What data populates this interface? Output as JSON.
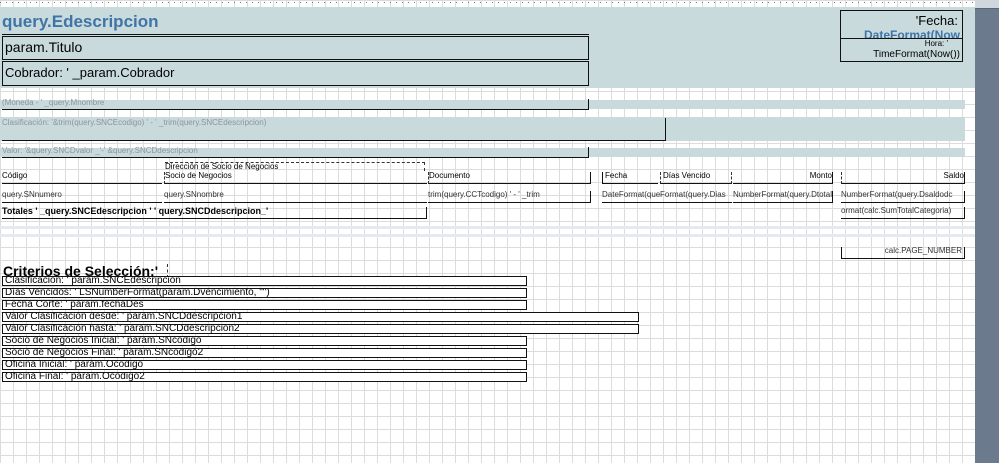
{
  "header": {
    "query_title": "query.Edescripcion",
    "param_title": "param.Titulo",
    "cobrador": "Cobrador: ' _param.Cobrador",
    "fecha": "'Fecha:",
    "fecha_format": "DateFormat(Now",
    "hora": "Hora: '",
    "time_format": "TimeFormat(Now())"
  },
  "group": {
    "moneda": "(Moneda - ' _query.Mnombre",
    "clasificacion": "Clasificación: '&trim(query.SNCEcodigo) ' - ' _trim(query.SNCEdescripcion)",
    "valor": "Valor: '&query.SNCDvalor _'-' &query.SNCDdescripcion"
  },
  "columns": {
    "direccion": "Dirección de Socio de Negocios",
    "codigo": "Código",
    "socio": "Socio de Negocios",
    "documento": "Documento",
    "fecha": "Fecha",
    "dias_vencido": "Días Vencido",
    "monto": "Monto",
    "saldo": "Saldo"
  },
  "detail": {
    "codigo": "query.SNnumero",
    "socio": "query.SNnombre",
    "documento": "trim(query.CCTcodigo) ' - ' _trim",
    "fecha": "DateFormat(query.",
    "dias": "Format(query.Dias",
    "numberformat": "NumberFormat(query.Dtotal)",
    "saldo": "NumberFormat(query.Dsaldodc"
  },
  "totals": {
    "label": "Totales ' _query.SNCEdescripcion ' ' query.SNCDdescripcion_'",
    "value": "ormat(calc.SumTotalCategoria)"
  },
  "footer": {
    "page_number": "calc.PAGE_NUMBER"
  },
  "criteria": {
    "heading": "Criterios de Selección:'",
    "items": [
      "Clasificación: ' param.SNCEdescripcion",
      "Días Vencidos: ' LSNumberFormat(param.Dvencimiento, \"\")",
      "Fecha Corte: ' param.fechaDes",
      "Valor Clasificación desde: ' param.SNCDdescripcion1",
      "Valor Clasificación hasta: ' param.SNCDdescripcion2",
      "Socio de Negocios Inicial: ' param.SNcodigo",
      "Socio de Negocios Final: ' param.SNcodigo2",
      "Oficina Inicial: ' param.Ocodigo",
      "Oficina Final: ' param.Ocodigo2"
    ]
  },
  "colors": {
    "band": "#c9dadd",
    "title_blue": "#3f74a6",
    "scrollbar": "#6b7a8c"
  }
}
